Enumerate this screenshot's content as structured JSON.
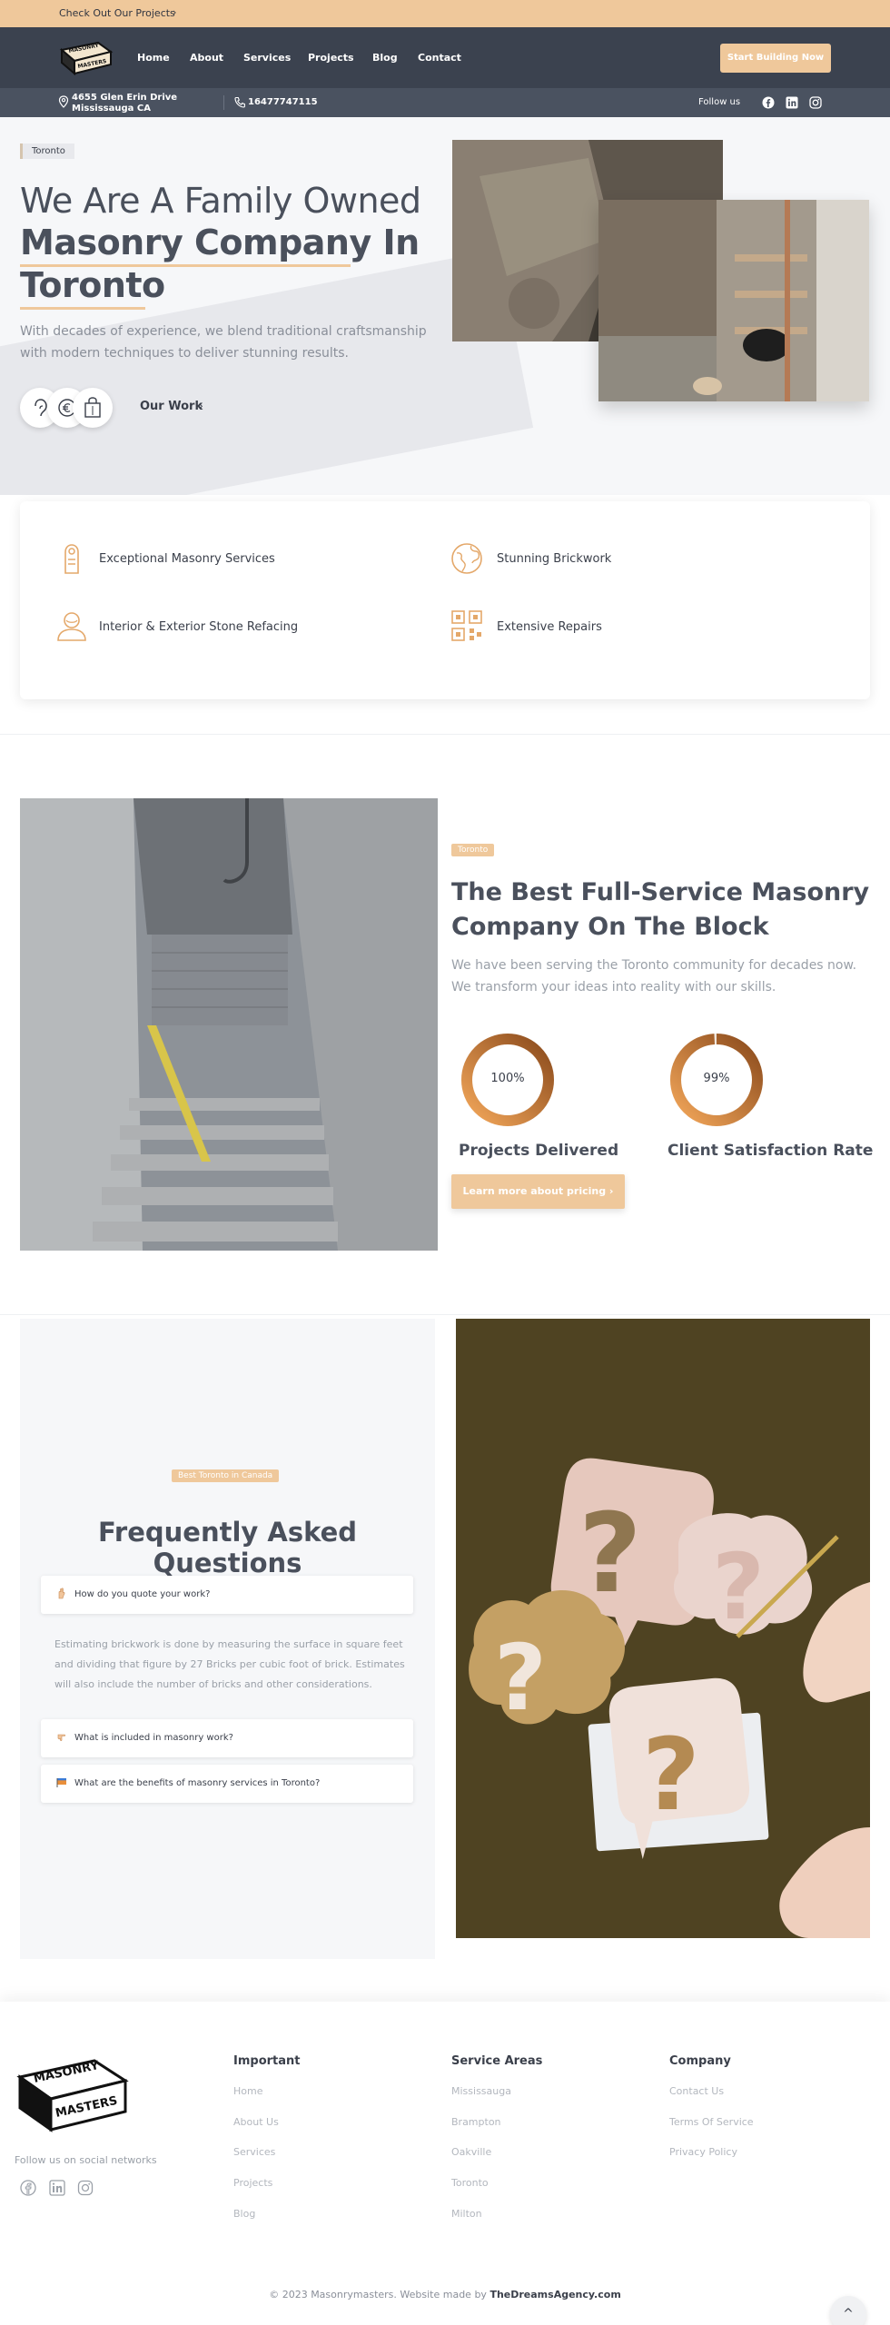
{
  "promo": {
    "text": "Check Out Our Projects",
    "chevron": "›"
  },
  "nav": {
    "logo_line1": "MASONRY",
    "logo_line2": "MASTERS",
    "items": [
      {
        "label": "Home"
      },
      {
        "label": "About"
      },
      {
        "label": "Services"
      },
      {
        "label": "Projects"
      },
      {
        "label": "Blog"
      },
      {
        "label": "Contact"
      }
    ],
    "cta": "Start Building Now"
  },
  "infobar": {
    "address_line1": "4655 Glen Erin Drive",
    "address_line2": "Mississauga CA",
    "phone": "16477747115",
    "follow": "Follow us",
    "social_icons": [
      "facebook-icon",
      "linkedin-icon",
      "instagram-icon"
    ]
  },
  "hero": {
    "badge": "Toronto",
    "title_line1": "We Are A Family Owned",
    "title_line2": "Masonry Company In",
    "title_line3": "Toronto",
    "desc_line1": "With decades of experience, we blend traditional craftsmanship",
    "desc_line2": "with modern techniques to deliver stunning results.",
    "our_work": "Our Work",
    "chevron": "›"
  },
  "features": [
    {
      "label": "Exceptional Masonry Services",
      "icon": "door-hanger-icon"
    },
    {
      "label": "Stunning Brickwork",
      "icon": "globe-icon"
    },
    {
      "label": "Interior & Exterior Stone Refacing",
      "icon": "user-outline-icon"
    },
    {
      "label": "Extensive Repairs",
      "icon": "qr-code-icon"
    }
  ],
  "about": {
    "badge": "Toronto",
    "title_line1": "The Best Full-Service Masonry",
    "title_line2": "Company On The Block",
    "desc_line1": "We have been serving the Toronto community for decades now.",
    "desc_line2": "We transform your ideas into reality with our skills.",
    "stats": [
      {
        "value": "100%",
        "label": "Projects Delivered",
        "fraction": 1.0
      },
      {
        "value": "99%",
        "label": "Client Satisfaction Rate",
        "fraction": 0.99
      }
    ],
    "cta": "Learn more about pricing ›"
  },
  "faq": {
    "badge": "Best Toronto in Canada",
    "title": "Frequently Asked Questions",
    "items": [
      {
        "question": "How do you quote your work?"
      },
      {
        "question": "What is included in masonry work?"
      },
      {
        "question": "What are the benefits of masonry services in Toronto?"
      }
    ],
    "answer_line1": "Estimating brickwork is done by measuring the surface in square feet",
    "answer_line2": "and dividing that figure by 27 Bricks per cubic foot of brick. Estimates",
    "answer_line3": "will also include the number of bricks and other considerations."
  },
  "footer": {
    "follow": "Follow us on social networks",
    "columns": [
      {
        "heading": "Important",
        "links": [
          "Home",
          "About Us",
          "Services",
          "Projects",
          "Blog"
        ]
      },
      {
        "heading": "Service Areas",
        "links": [
          "Mississauga",
          "Brampton",
          "Oakville",
          "Toronto",
          "Milton"
        ]
      },
      {
        "heading": "Company",
        "links": [
          "Contact Us",
          "Terms Of Service",
          "Privacy Policy"
        ]
      }
    ],
    "copyright": "© 2023 Masonrymasters. Website made by ",
    "agency": "TheDreamsAgency.com",
    "scroll_top": "^"
  },
  "colors": {
    "accent": "#efc89b",
    "nav_bg": "#3b424f",
    "text_dark": "#4a505c",
    "ring_orange": "#e07a2a"
  }
}
